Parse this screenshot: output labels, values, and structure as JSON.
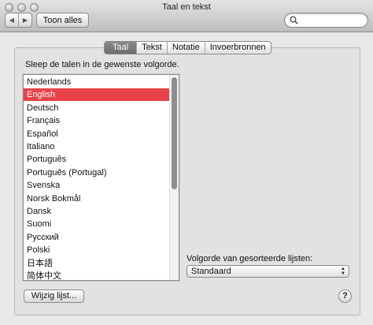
{
  "window": {
    "title": "Taal en tekst"
  },
  "toolbar": {
    "back_icon": "left-triangle",
    "forward_icon": "right-triangle",
    "show_all_label": "Toon alles",
    "search_placeholder": ""
  },
  "tabs": [
    {
      "label": "Taal",
      "active": true
    },
    {
      "label": "Tekst",
      "active": false
    },
    {
      "label": "Notatie",
      "active": false
    },
    {
      "label": "Invoerbronnen",
      "active": false
    }
  ],
  "language_panel": {
    "instruction": "Sleep de talen in de gewenste volgorde.",
    "languages": [
      "Nederlands",
      "English",
      "Deutsch",
      "Français",
      "Español",
      "Italiano",
      "Português",
      "Português (Portugal)",
      "Svenska",
      "Norsk Bokmål",
      "Dansk",
      "Suomi",
      "Русский",
      "Polski",
      "日本語",
      "简体中文"
    ],
    "selected_index": 1,
    "selection_color": "#e8434a",
    "sort_label": "Volgorde van gesorteerde lijsten:",
    "sort_value": "Standaard",
    "edit_list_label": "Wijzig lijst...",
    "help_label": "?"
  }
}
